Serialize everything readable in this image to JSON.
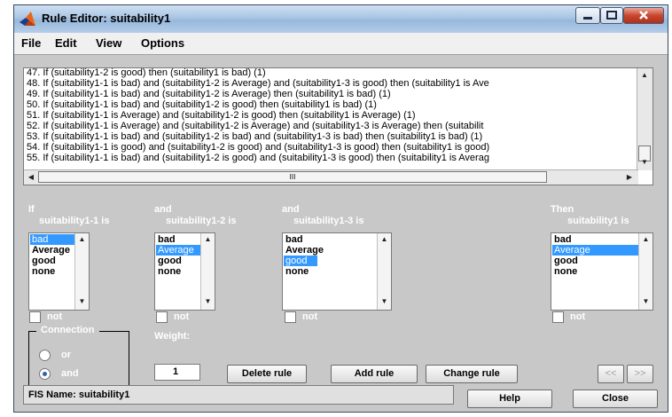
{
  "window": {
    "title": "Rule Editor: suitability1"
  },
  "menu": [
    "File",
    "Edit",
    "View",
    "Options"
  ],
  "rules": [
    "47. If (suitability1-2 is good) then (suitability1 is bad) (1)",
    "48. If (suitability1-1 is bad) and (suitability1-2 is Average) and (suitability1-3 is good) then (suitability1 is Ave",
    "49. If (suitability1-1 is bad) and (suitability1-2 is Average) then (suitability1 is bad) (1)",
    "50. If (suitability1-1 is bad) and (suitability1-2 is good) then (suitability1 is bad) (1)",
    "51. If (suitability1-1 is Average) and (suitability1-2 is good) then (suitability1 is Average) (1)",
    "52. If (suitability1-1 is Average) and (suitability1-2 is Average) and (suitability1-3 is Average) then (suitabilit",
    "53. If (suitability1-1 is bad) and (suitability1-2 is bad) and (suitability1-3 is bad) then (suitability1 is bad) (1)",
    "54. If (suitability1-1 is good) and (suitability1-2 is good) and (suitability1-3 is good) then (suitability1 is good)",
    "55. If (suitability1-1 is bad) and (suitability1-2 is good) and (suitability1-3 is good) then (suitability1 is Averag"
  ],
  "scroll": {
    "h_thumb_glyph": "III"
  },
  "inputs": [
    {
      "prefix": "If",
      "name": "suitability1-1 is",
      "options": [
        "bad",
        "Average",
        "good",
        "none"
      ],
      "selected": "bad",
      "not_label": "not"
    },
    {
      "prefix": "and",
      "name": "suitability1-2 is",
      "options": [
        "bad",
        "Average",
        "good",
        "none"
      ],
      "selected": "Average",
      "not_label": "not"
    },
    {
      "prefix": "and",
      "name": "suitability1-3 is",
      "options": [
        "bad",
        "Average",
        "good",
        "none"
      ],
      "selected": "good",
      "not_label": "not"
    }
  ],
  "output": {
    "prefix": "Then",
    "name": "suitability1 is",
    "options": [
      "bad",
      "Average",
      "good",
      "none"
    ],
    "selected": "Average",
    "not_label": "not"
  },
  "connection": {
    "title": "Connection",
    "options": [
      "or",
      "and"
    ],
    "selected": "and"
  },
  "weight": {
    "label": "Weight:",
    "value": "1"
  },
  "buttons": {
    "delete": "Delete rule",
    "add": "Add rule",
    "change": "Change rule",
    "prev": "<<",
    "next": ">>",
    "help": "Help",
    "close": "Close"
  },
  "status": "FIS Name: suitability1",
  "colors": {
    "selection": "#3399ff",
    "panel": "#c8c8c8",
    "close_button": "#c8462e"
  }
}
